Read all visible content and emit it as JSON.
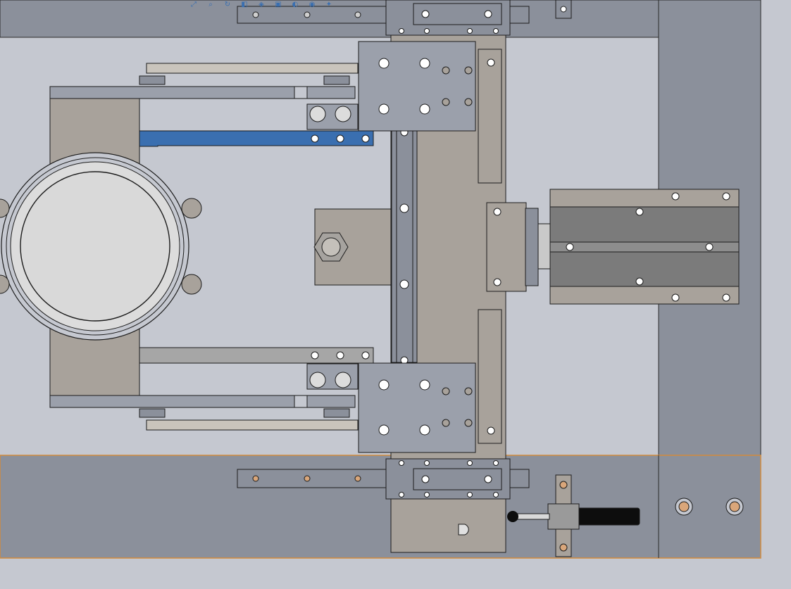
{
  "colors": {
    "background": "#c5c8d0",
    "panel": "#8b909b",
    "panel_light": "#c5c8d0",
    "plate": "#9ba0ab",
    "rail": "#a6a39f",
    "tan": "#a8a29b",
    "slider_dark": "#7b7b7b",
    "highlight_finger": "#3a6fb0",
    "selection_edge": "#d28a3c",
    "bolt": "#ffffff",
    "stroke": "#1c1c1c"
  },
  "toolbar": {
    "icons": [
      "zoom-to-fit-icon",
      "zoom-area-icon",
      "rotate-view-icon",
      "section-view-icon",
      "view-orientation-icon",
      "display-style-icon",
      "hide-show-icon",
      "edit-appearance-icon",
      "scene-icon"
    ]
  }
}
